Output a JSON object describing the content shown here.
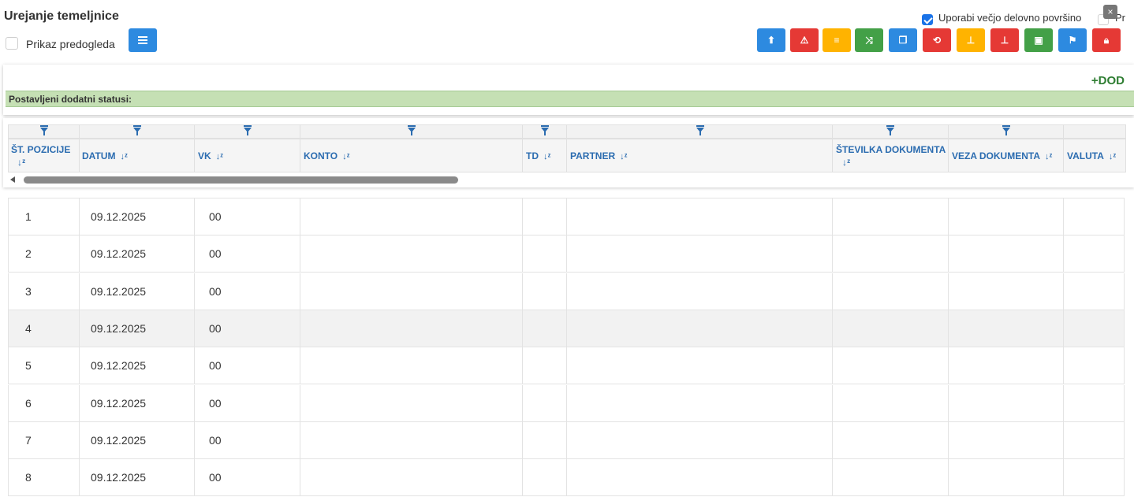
{
  "header": {
    "title": "Urejanje temeljnice",
    "preview_label": "Prikaz predogleda",
    "large_area_label": "Uporabi večjo delovno površino",
    "truncated_label": "Pr",
    "close_label": "×"
  },
  "toolbar": {
    "buttons": [
      {
        "icon": "upload-icon",
        "color": "#2d8ae0"
      },
      {
        "icon": "warning-icon",
        "color": "#e53935"
      },
      {
        "icon": "list-icon",
        "color": "#ffb300"
      },
      {
        "icon": "shuffle-icon",
        "color": "#43a047"
      },
      {
        "icon": "copy-icon",
        "color": "#2d8ae0"
      },
      {
        "icon": "repeat-icon",
        "color": "#e53935"
      },
      {
        "icon": "stamp-icon",
        "color": "#ffb300"
      },
      {
        "icon": "stamp-remove-icon",
        "color": "#e53935"
      },
      {
        "icon": "save-icon",
        "color": "#43a047"
      },
      {
        "icon": "flag-icon",
        "color": "#2d8ae0"
      },
      {
        "icon": "lock-icon",
        "color": "#e53935"
      }
    ]
  },
  "panel": {
    "add_label": "+DOD",
    "status_label": "Postavljeni dodatni statusi:"
  },
  "columns": [
    {
      "label": "ŠT. POZICIJE"
    },
    {
      "label": "DATUM"
    },
    {
      "label": "VK"
    },
    {
      "label": "KONTO"
    },
    {
      "label": "TD"
    },
    {
      "label": "PARTNER"
    },
    {
      "label": "ŠTEVILKA DOKUMENTA"
    },
    {
      "label": "VEZA DOKUMENTA"
    },
    {
      "label": "VALUTA"
    }
  ],
  "rows": [
    {
      "pos": "1",
      "date": "09.12.2025",
      "vk": "00"
    },
    {
      "pos": "2",
      "date": "09.12.2025",
      "vk": "00"
    },
    {
      "pos": "3",
      "date": "09.12.2025",
      "vk": "00"
    },
    {
      "pos": "4",
      "date": "09.12.2025",
      "vk": "00"
    },
    {
      "pos": "5",
      "date": "09.12.2025",
      "vk": "00"
    },
    {
      "pos": "6",
      "date": "09.12.2025",
      "vk": "00"
    },
    {
      "pos": "7",
      "date": "09.12.2025",
      "vk": "00"
    },
    {
      "pos": "8",
      "date": "09.12.2025",
      "vk": "00"
    }
  ]
}
